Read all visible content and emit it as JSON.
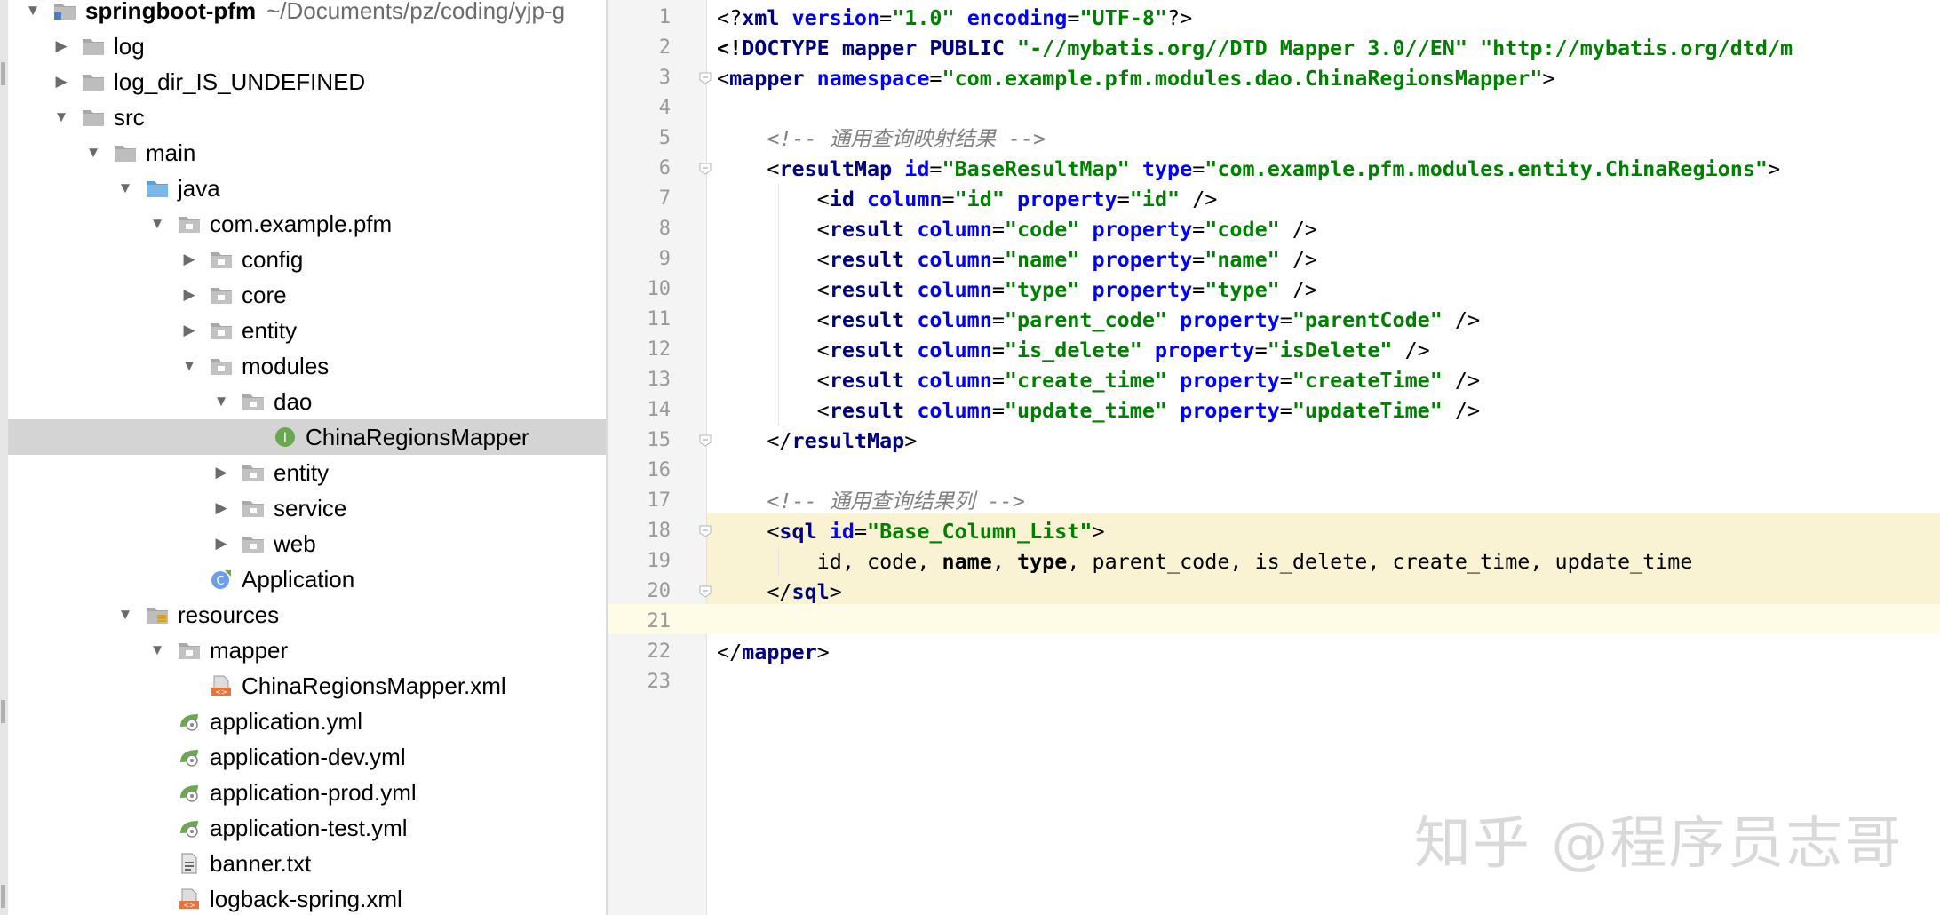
{
  "tree": {
    "items": [
      {
        "label": "springboot-pfm",
        "path": "~/Documents/pz/coding/yjp-g",
        "icon": "module-folder-icon",
        "arrow": "down",
        "bold": true
      },
      {
        "label": "log",
        "icon": "folder-icon",
        "arrow": "right"
      },
      {
        "label": "log_dir_IS_UNDEFINED",
        "icon": "folder-icon",
        "arrow": "right"
      },
      {
        "label": "src",
        "icon": "folder-icon",
        "arrow": "down"
      },
      {
        "label": "main",
        "icon": "folder-icon",
        "arrow": "down"
      },
      {
        "label": "java",
        "icon": "source-folder-icon",
        "arrow": "down"
      },
      {
        "label": "com.example.pfm",
        "icon": "package-icon",
        "arrow": "down"
      },
      {
        "label": "config",
        "icon": "package-icon",
        "arrow": "right"
      },
      {
        "label": "core",
        "icon": "package-icon",
        "arrow": "right"
      },
      {
        "label": "entity",
        "icon": "package-icon",
        "arrow": "right"
      },
      {
        "label": "modules",
        "icon": "package-icon",
        "arrow": "down"
      },
      {
        "label": "dao",
        "icon": "package-icon",
        "arrow": "down"
      },
      {
        "label": "ChinaRegionsMapper",
        "icon": "interface-icon",
        "arrow": "none",
        "selected": true
      },
      {
        "label": "entity",
        "icon": "package-icon",
        "arrow": "right"
      },
      {
        "label": "service",
        "icon": "package-icon",
        "arrow": "right"
      },
      {
        "label": "web",
        "icon": "package-icon",
        "arrow": "right"
      },
      {
        "label": "Application",
        "icon": "spring-boot-class-icon",
        "arrow": "none"
      },
      {
        "label": "resources",
        "icon": "resources-folder-icon",
        "arrow": "down"
      },
      {
        "label": "mapper",
        "icon": "package-icon",
        "arrow": "down"
      },
      {
        "label": "ChinaRegionsMapper.xml",
        "icon": "xml-file-icon",
        "arrow": "none"
      },
      {
        "label": "application.yml",
        "icon": "spring-yml-icon",
        "arrow": "none"
      },
      {
        "label": "application-dev.yml",
        "icon": "spring-yml-icon",
        "arrow": "none"
      },
      {
        "label": "application-prod.yml",
        "icon": "spring-yml-icon",
        "arrow": "none"
      },
      {
        "label": "application-test.yml",
        "icon": "spring-yml-icon",
        "arrow": "none"
      },
      {
        "label": "banner.txt",
        "icon": "text-file-icon",
        "arrow": "none"
      },
      {
        "label": "logback-spring.xml",
        "icon": "xml-file-icon",
        "arrow": "none"
      }
    ]
  },
  "editor": {
    "line_numbers": [
      "1",
      "2",
      "3",
      "4",
      "5",
      "6",
      "7",
      "8",
      "9",
      "10",
      "11",
      "12",
      "13",
      "14",
      "15",
      "16",
      "17",
      "18",
      "19",
      "20",
      "21",
      "22",
      "23"
    ],
    "lines": [
      [
        [
          "pn",
          "<?"
        ],
        [
          "t",
          "xml "
        ],
        [
          "a",
          "version"
        ],
        [
          "pn",
          "="
        ],
        [
          "v",
          "\"1.0\" "
        ],
        [
          "a",
          "encoding"
        ],
        [
          "pn",
          "="
        ],
        [
          "v",
          "\"UTF-8\""
        ],
        [
          "pn",
          "?>"
        ]
      ],
      [
        [
          "bk",
          "<!"
        ],
        [
          "t",
          "DOCTYPE "
        ],
        [
          "t",
          "mapper "
        ],
        [
          "t",
          "PUBLIC "
        ],
        [
          "v",
          "\"-//mybatis.org//DTD Mapper 3.0//EN\" "
        ],
        [
          "v",
          "\"http://mybatis.org/dtd/m"
        ]
      ],
      [
        [
          "pn",
          "<"
        ],
        [
          "t",
          "mapper "
        ],
        [
          "a",
          "namespace"
        ],
        [
          "pn",
          "="
        ],
        [
          "v",
          "\"com.example.pfm.modules.dao.ChinaRegionsMapper\""
        ],
        [
          "pn",
          ">"
        ]
      ],
      [],
      [
        [
          "c",
          "    <!-- 通用查询映射结果 -->"
        ]
      ],
      [
        [
          "pn",
          "    <"
        ],
        [
          "t",
          "resultMap "
        ],
        [
          "a",
          "id"
        ],
        [
          "pn",
          "="
        ],
        [
          "v",
          "\"BaseResultMap\" "
        ],
        [
          "a",
          "type"
        ],
        [
          "pn",
          "="
        ],
        [
          "v",
          "\"com.example.pfm.modules.entity.ChinaRegions\""
        ],
        [
          "pn",
          ">"
        ]
      ],
      [
        [
          "pn",
          "        <"
        ],
        [
          "t",
          "id "
        ],
        [
          "a",
          "column"
        ],
        [
          "pn",
          "="
        ],
        [
          "v",
          "\"id\" "
        ],
        [
          "a",
          "property"
        ],
        [
          "pn",
          "="
        ],
        [
          "v",
          "\"id\" "
        ],
        [
          "pn",
          "/>"
        ]
      ],
      [
        [
          "pn",
          "        <"
        ],
        [
          "t",
          "result "
        ],
        [
          "a",
          "column"
        ],
        [
          "pn",
          "="
        ],
        [
          "v",
          "\"code\" "
        ],
        [
          "a",
          "property"
        ],
        [
          "pn",
          "="
        ],
        [
          "v",
          "\"code\" "
        ],
        [
          "pn",
          "/>"
        ]
      ],
      [
        [
          "pn",
          "        <"
        ],
        [
          "t",
          "result "
        ],
        [
          "a",
          "column"
        ],
        [
          "pn",
          "="
        ],
        [
          "v",
          "\"name\" "
        ],
        [
          "a",
          "property"
        ],
        [
          "pn",
          "="
        ],
        [
          "v",
          "\"name\" "
        ],
        [
          "pn",
          "/>"
        ]
      ],
      [
        [
          "pn",
          "        <"
        ],
        [
          "t",
          "result "
        ],
        [
          "a",
          "column"
        ],
        [
          "pn",
          "="
        ],
        [
          "v",
          "\"type\" "
        ],
        [
          "a",
          "property"
        ],
        [
          "pn",
          "="
        ],
        [
          "v",
          "\"type\" "
        ],
        [
          "pn",
          "/>"
        ]
      ],
      [
        [
          "pn",
          "        <"
        ],
        [
          "t",
          "result "
        ],
        [
          "a",
          "column"
        ],
        [
          "pn",
          "="
        ],
        [
          "v",
          "\"parent_code\" "
        ],
        [
          "a",
          "property"
        ],
        [
          "pn",
          "="
        ],
        [
          "v",
          "\"parentCode\" "
        ],
        [
          "pn",
          "/>"
        ]
      ],
      [
        [
          "pn",
          "        <"
        ],
        [
          "t",
          "result "
        ],
        [
          "a",
          "column"
        ],
        [
          "pn",
          "="
        ],
        [
          "v",
          "\"is_delete\" "
        ],
        [
          "a",
          "property"
        ],
        [
          "pn",
          "="
        ],
        [
          "v",
          "\"isDelete\" "
        ],
        [
          "pn",
          "/>"
        ]
      ],
      [
        [
          "pn",
          "        <"
        ],
        [
          "t",
          "result "
        ],
        [
          "a",
          "column"
        ],
        [
          "pn",
          "="
        ],
        [
          "v",
          "\"create_time\" "
        ],
        [
          "a",
          "property"
        ],
        [
          "pn",
          "="
        ],
        [
          "v",
          "\"createTime\" "
        ],
        [
          "pn",
          "/>"
        ]
      ],
      [
        [
          "pn",
          "        <"
        ],
        [
          "t",
          "result "
        ],
        [
          "a",
          "column"
        ],
        [
          "pn",
          "="
        ],
        [
          "v",
          "\"update_time\" "
        ],
        [
          "a",
          "property"
        ],
        [
          "pn",
          "="
        ],
        [
          "v",
          "\"updateTime\" "
        ],
        [
          "pn",
          "/>"
        ]
      ],
      [
        [
          "pn",
          "    </"
        ],
        [
          "t",
          "resultMap"
        ],
        [
          "pn",
          ">"
        ]
      ],
      [],
      [
        [
          "c",
          "    <!-- 通用查询结果列 -->"
        ]
      ],
      [
        [
          "pn",
          "    <"
        ],
        [
          "t",
          "sql "
        ],
        [
          "a",
          "id"
        ],
        [
          "pn",
          "="
        ],
        [
          "v",
          "\"Base_Column_List\""
        ],
        [
          "pn",
          ">"
        ]
      ],
      [
        [
          "pn",
          "        id, code, "
        ],
        [
          "bk",
          "name"
        ],
        [
          "pn",
          ", "
        ],
        [
          "bk",
          "type"
        ],
        [
          "pn",
          ", parent_code, is_delete, create_time, update_time"
        ]
      ],
      [
        [
          "pn",
          "    </"
        ],
        [
          "t",
          "sql"
        ],
        [
          "pn",
          ">"
        ]
      ],
      [],
      [
        [
          "pn",
          "</"
        ],
        [
          "t",
          "mapper"
        ],
        [
          "pn",
          ">"
        ]
      ],
      []
    ]
  },
  "watermark": "知乎 @程序员志哥",
  "colors": {
    "tag": "#000080",
    "attribute": "#0000ff",
    "value": "#008000",
    "comment": "#808080",
    "selection": "#d4d4d4",
    "sql_highlight": "#faf3d3",
    "caret_line": "#fefbe6"
  }
}
